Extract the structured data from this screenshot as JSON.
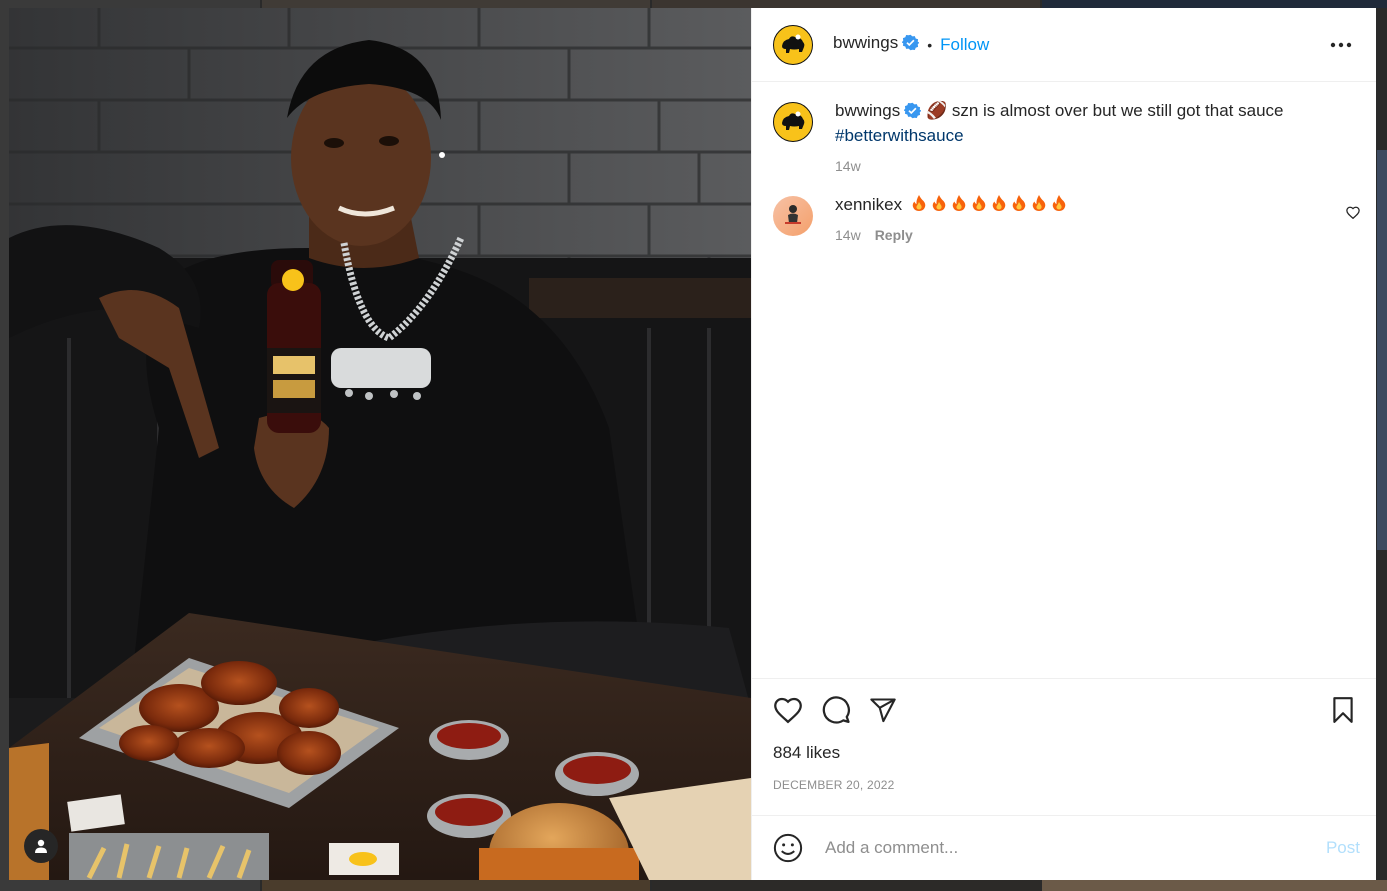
{
  "post": {
    "author": "bwwings",
    "follow_label": "Follow",
    "separator": "•",
    "caption_emoji": "🏈",
    "caption_text": "szn is almost over but we still got that sauce",
    "caption_hashtag": "#betterwithsauce",
    "caption_age": "14w",
    "likes": "884 likes",
    "date": "DECEMBER 20, 2022"
  },
  "comments": [
    {
      "username": "xennikex",
      "fire_count": 8,
      "age": "14w",
      "reply_label": "Reply"
    }
  ],
  "comment_box": {
    "placeholder": "Add a comment...",
    "post_label": "Post"
  },
  "colors": {
    "accent": "#0095f6",
    "post_disabled": "#b2dffc",
    "hashtag": "#00376b",
    "verified": "#3897f0",
    "brand_yellow": "#f8c21a"
  },
  "icons": [
    "buffalo-logo-icon",
    "verified-icon",
    "more-icon",
    "heart-icon",
    "comment-icon",
    "share-icon",
    "bookmark-icon",
    "emoji-icon",
    "fire-icon",
    "person-icon"
  ]
}
